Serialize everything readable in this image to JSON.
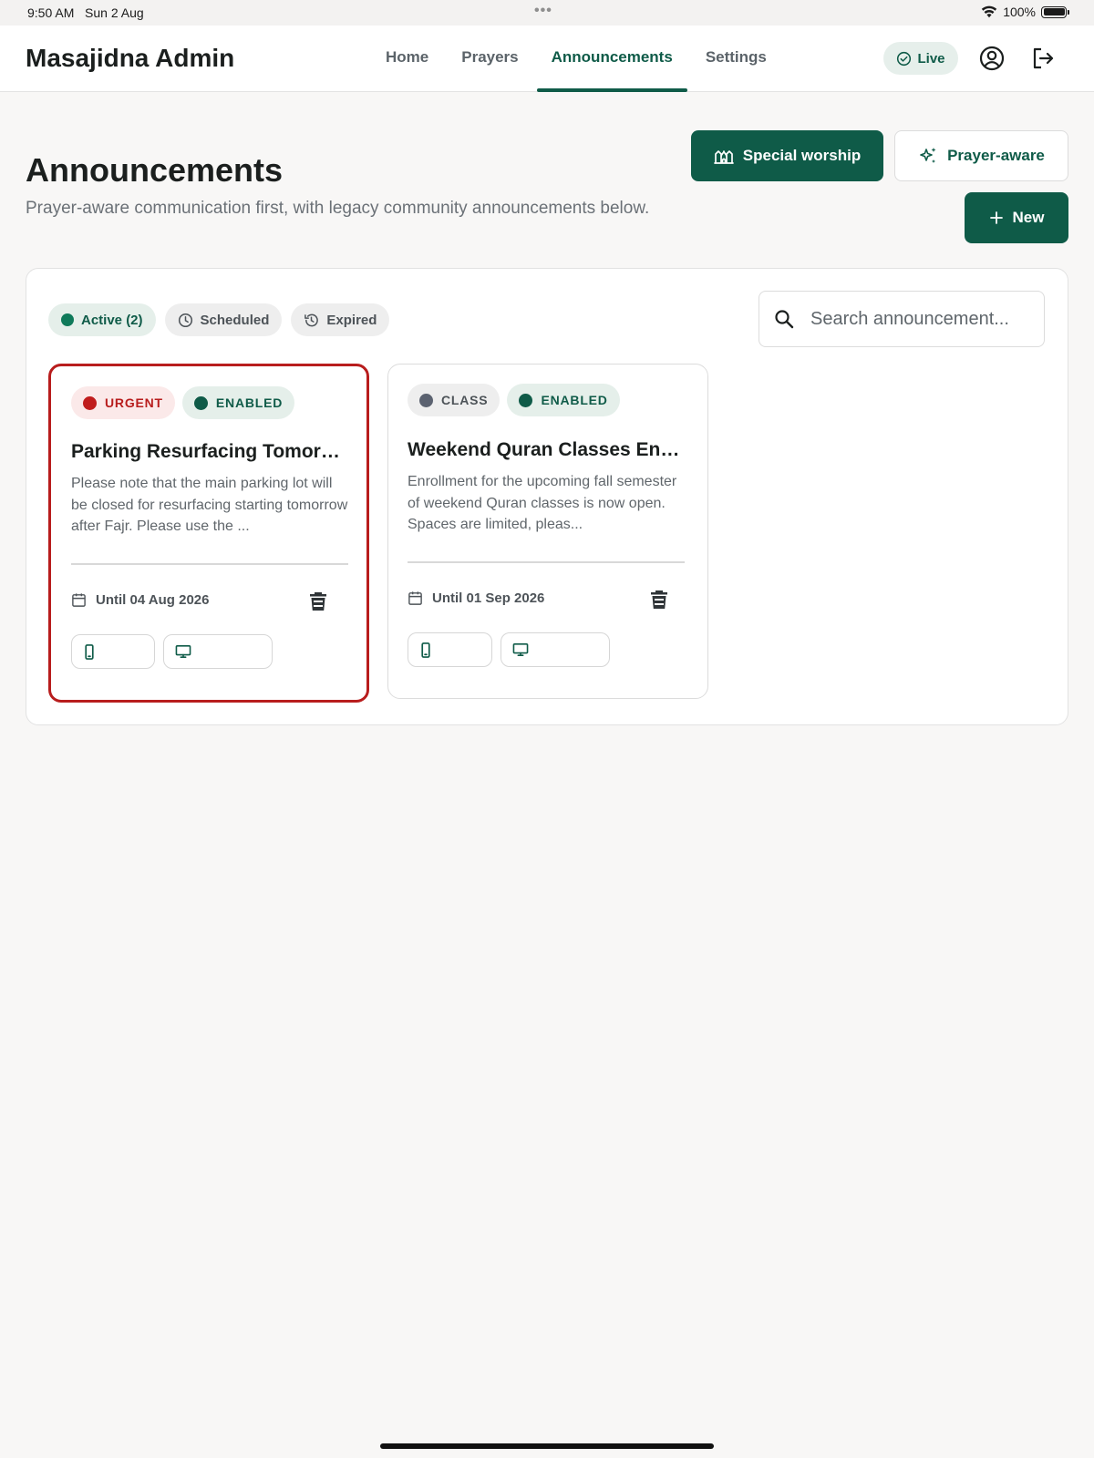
{
  "status_bar": {
    "time": "9:50 AM",
    "date": "Sun 2 Aug",
    "battery": "100%"
  },
  "nav": {
    "brand": "Masajidna Admin",
    "links": [
      "Home",
      "Prayers",
      "Announcements",
      "Settings"
    ],
    "active_link": "Announcements",
    "live_label": "Live",
    "icons": [
      "account-circle-icon",
      "logout-icon"
    ]
  },
  "header": {
    "title": "Announcements",
    "subtitle": "Prayer-aware communication first, with legacy community announcements below.",
    "special_worship_label": "Special worship",
    "prayer_aware_label": "Prayer-aware",
    "new_label": "New"
  },
  "filters": {
    "chips": [
      "Active (2)",
      "Scheduled",
      "Expired"
    ],
    "active_chip": "Active (2)",
    "search_placeholder": "Search announcement..."
  },
  "cards": [
    {
      "category": "URGENT",
      "status": "ENABLED",
      "title": "Parking Resurfacing Tomorrow",
      "body": "Please note that the main parking lot will be closed for resurfacing starting tomorrow after Fajr. Please use the ...",
      "until": "Until 04 Aug 2026",
      "channels": [
        "mobile-icon",
        "display-icon"
      ]
    },
    {
      "category": "CLASS",
      "status": "ENABLED",
      "title": "Weekend Quran Classes Enrollment",
      "body": "Enrollment for the upcoming fall semester of weekend Quran classes is now open. Spaces are limited, pleas...",
      "until": "Until 01 Sep 2026",
      "channels": [
        "mobile-icon",
        "display-icon"
      ]
    }
  ],
  "colors": {
    "brand_green": "#0f5b48",
    "urgent_red": "#b81d1d",
    "class_gray": "#5b6270",
    "background": "#f8f7f6"
  }
}
